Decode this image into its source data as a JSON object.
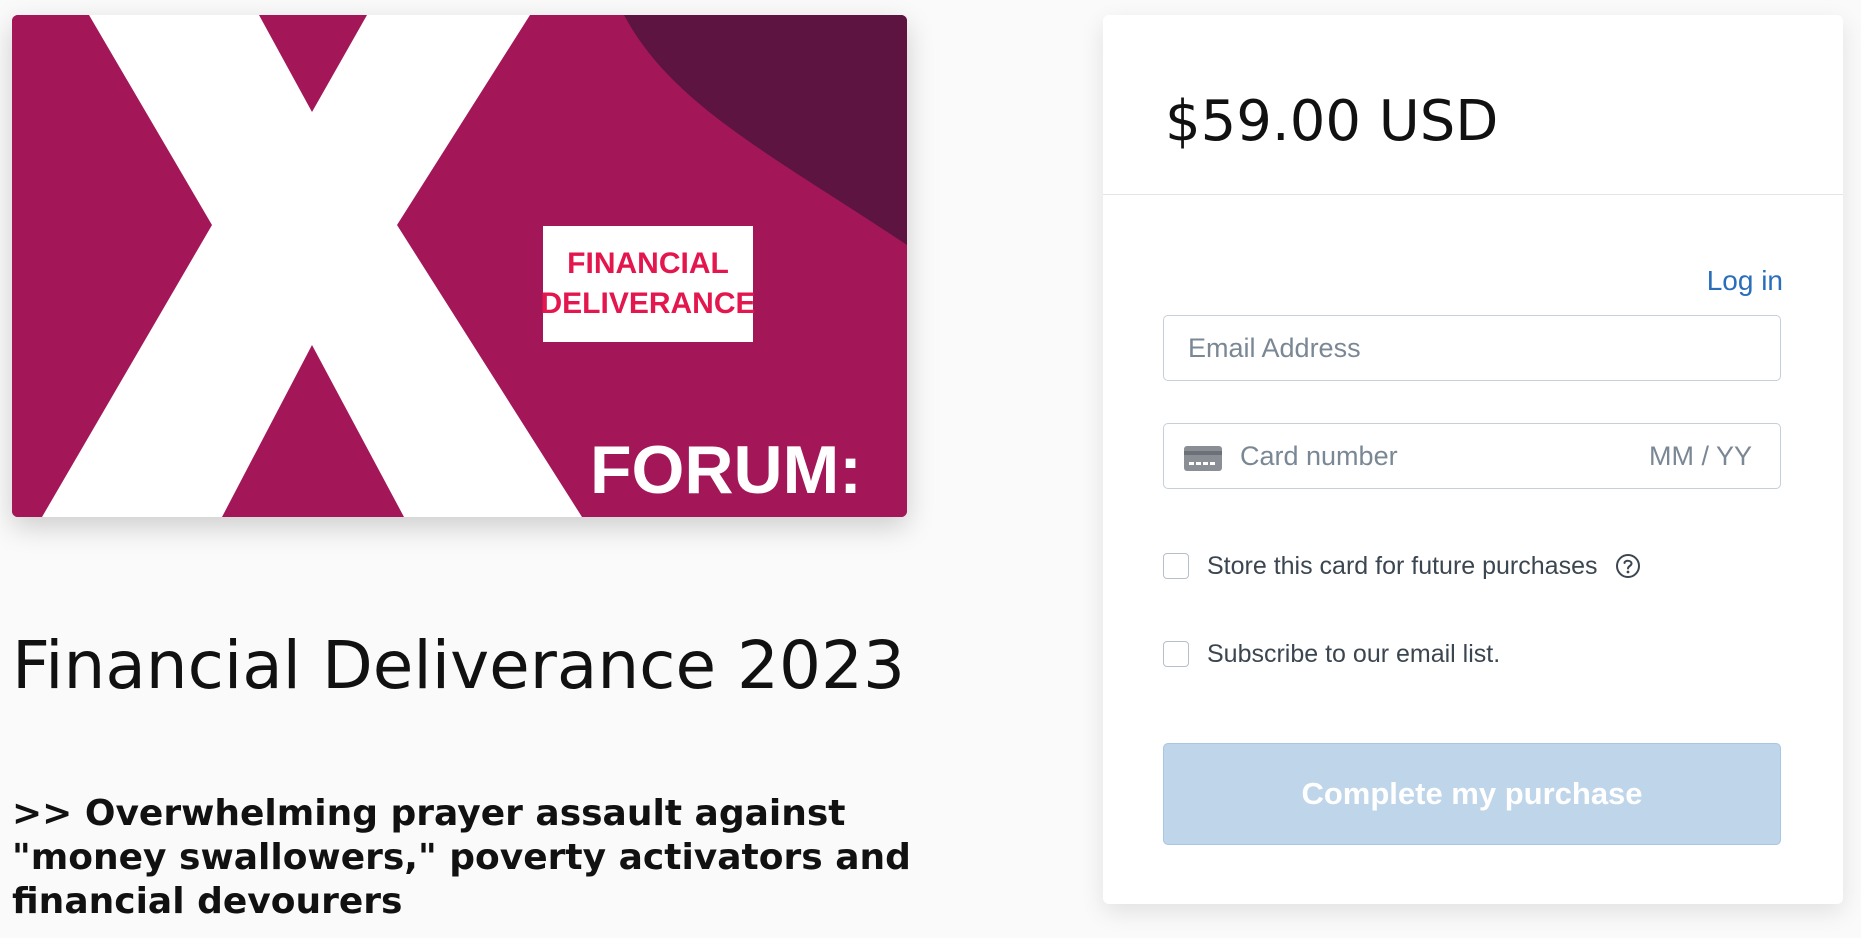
{
  "product": {
    "image": {
      "badge_line1": "FINANCIAL",
      "badge_line2": "DELIVERANCE",
      "forum_text": "FORUM:",
      "colors": {
        "background": "#a31759",
        "corner": "#5e1440",
        "x_mark": "#ffffff",
        "badge_text": "#e3164d"
      }
    },
    "title": "Financial Deliverance 2023",
    "description": ">> Overwhelming prayer assault against \"money swallowers,\" poverty activators and financial devourers"
  },
  "checkout": {
    "price": "$59.00 USD",
    "login_link": "Log in",
    "email_placeholder": "Email Address",
    "card_icon": "credit-card-icon",
    "card_placeholder": "Card number",
    "expiry_placeholder": "MM / YY",
    "store_card_label": "Store this card for future purchases",
    "help_icon": "question-circle-icon",
    "subscribe_label": "Subscribe to our email list.",
    "submit_label": "Complete my purchase",
    "colors": {
      "link": "#2a6ebb",
      "button_disabled": "#bfd5ea"
    }
  }
}
